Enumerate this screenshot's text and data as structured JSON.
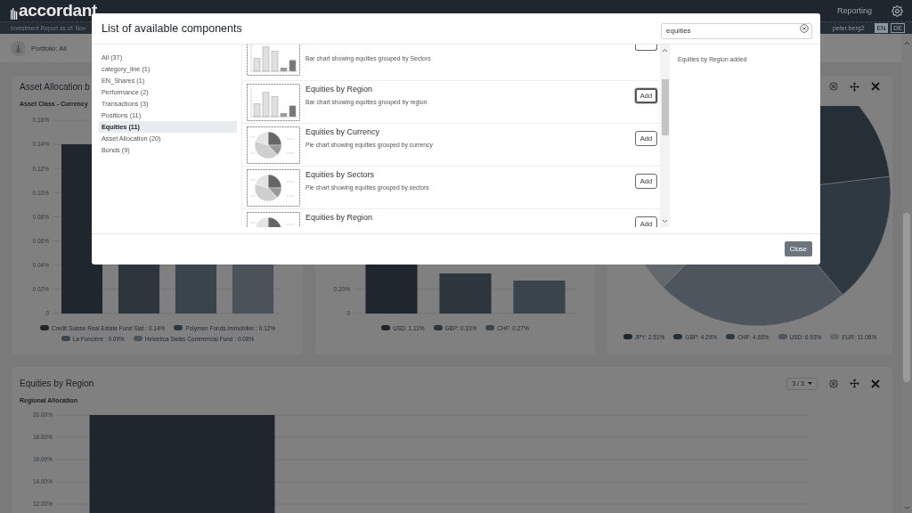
{
  "header": {
    "logo": "accordant",
    "nav_link": "Reporting",
    "report_date": "Investment Report as of: Nov",
    "user": "peter.berg2",
    "languages": [
      {
        "label": "EN",
        "selected": true
      },
      {
        "label": "DE",
        "selected": false
      }
    ]
  },
  "toolbar": {
    "portfolio": "Portfolio: All"
  },
  "cards": [
    {
      "kind": "bar",
      "title": "Asset Allocation b",
      "subtitle": "Asset Class - Currency",
      "y_axis_labels": [
        "0.16%",
        "0.14%",
        "0.12%",
        "0.10%",
        "0.08%",
        "0.06%",
        "0.04%",
        "0.02%",
        "0"
      ],
      "legend": [
        {
          "label": "Credit Suisse Real Estate Fund Siat : 0.14%",
          "color": "#1f262d"
        },
        {
          "label": "Polymen Fonds Immobilier : 0.12%",
          "color": "#2d353d"
        },
        {
          "label": "La Fonciere : 0.09%",
          "color": "#39444c"
        },
        {
          "label": "Helvetica Swiss Commercial Fund : 0.08%",
          "color": "#4b5259"
        }
      ]
    },
    {
      "kind": "bar",
      "y_axis_labels": [
        "0.20%",
        "0"
      ],
      "legend": [
        {
          "label": "USD: 1.11%",
          "color": "#1f262d"
        },
        {
          "label": "GBP: 0.33%",
          "color": "#2d353d"
        },
        {
          "label": "CHF: 0.27%",
          "color": "#39444c"
        }
      ]
    },
    {
      "kind": "pie",
      "controls": true,
      "legend": [
        {
          "label": "JPY: 2.51%",
          "color": "#1f262d"
        },
        {
          "label": "GBP: 4.29%",
          "color": "#262e36"
        },
        {
          "label": "CHF: 4.65%",
          "color": "#2f3942"
        },
        {
          "label": "USD: 6.93%",
          "color": "#4e555c"
        },
        {
          "label": "EUR: 11.06%",
          "color": "#63686d"
        }
      ]
    },
    {
      "kind": "chart",
      "title": "Equities by Region",
      "subtitle": "Regional Allocation",
      "controls": true,
      "pager": "3 / 3",
      "chart_data": {
        "type": "bar",
        "values": [
          20.0
        ],
        "ylim": [
          0,
          20
        ],
        "grid": true,
        "yticks": [
          {
            "value": 12,
            "label": "12.00%"
          },
          {
            "value": 14,
            "label": "14.00%"
          },
          {
            "value": 16,
            "label": "16.00%"
          },
          {
            "value": 18,
            "label": "18.00%"
          },
          {
            "value": 20,
            "label": "20.00%"
          }
        ]
      }
    }
  ],
  "modal": {
    "title": "List of available components",
    "search": {
      "value": "equities"
    },
    "categories": [
      {
        "label": "All (37)",
        "selected": false
      },
      {
        "label": "category_line (1)",
        "selected": false
      },
      {
        "label": "EN_Shares (1)",
        "selected": false
      },
      {
        "label": "Performance (2)",
        "selected": false
      },
      {
        "label": "Transactions (3)",
        "selected": false
      },
      {
        "label": "Positions (11)",
        "selected": false
      },
      {
        "label": "Equities (11)",
        "selected": true
      },
      {
        "label": "Asset Allocation (20)",
        "selected": false
      },
      {
        "label": "Bonds (9)",
        "selected": false
      }
    ],
    "components": [
      {
        "kind": "bar",
        "cut": true,
        "description": "Bar chart showing equities grouped by Sectors",
        "focused": false
      },
      {
        "kind": "bar",
        "title": "Equities by Region",
        "description": "Bar chart showing equities grouped by region",
        "button": "Add",
        "focused": true
      },
      {
        "kind": "pie",
        "title": "Equities by Currency",
        "description": "Pie chart showing equities grouped by currency",
        "button": "Add",
        "focused": false
      },
      {
        "kind": "pie",
        "title": "Equities by Sectors",
        "description": "Pie chart showing equities grouped by sectors",
        "button": "Add",
        "focused": false
      },
      {
        "kind": "pie",
        "title": "Equities by Region",
        "button": "Add",
        "focused": false
      }
    ],
    "messages": [
      "Equities by Region added"
    ],
    "close_button": "Close"
  }
}
